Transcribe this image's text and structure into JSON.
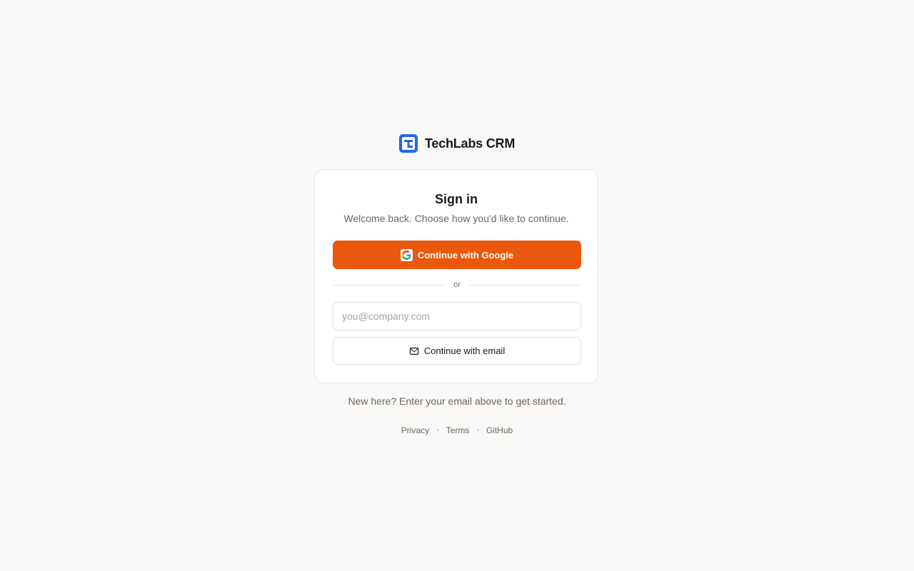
{
  "brand": {
    "name": "TechLabs CRM",
    "logo_icon": "techlabs-logo-icon",
    "color": "#2563eb"
  },
  "card": {
    "title": "Sign in",
    "subtitle": "Welcome back. Choose how you'd like to continue.",
    "google_button": {
      "label": "Continue with Google",
      "icon": "google-icon",
      "color": "#ea580c"
    },
    "divider_text": "or",
    "email_input": {
      "value": "",
      "placeholder": "you@company.com"
    },
    "email_button": {
      "label": "Continue with email",
      "icon": "mail-icon"
    }
  },
  "signup_hint": "New here? Enter your email above to get started.",
  "footer": {
    "links": [
      "Privacy",
      "Terms",
      "GitHub"
    ],
    "separator": "•"
  }
}
